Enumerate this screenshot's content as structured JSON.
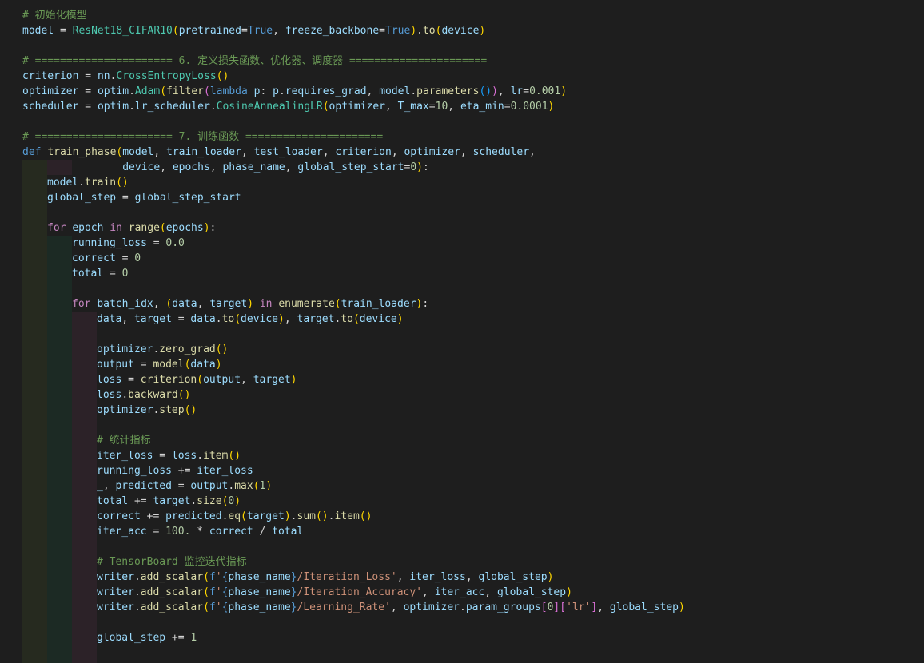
{
  "theme": {
    "background": "#1e1e1e",
    "token_colors": {
      "p": "#d4d4d4",
      "v": "#9cdcfe",
      "f": "#dcdcaa",
      "c": "#4ec9b0",
      "k": "#569cd6",
      "ctl": "#c586c0",
      "n": "#b5cea8",
      "s": "#ce9178",
      "cm": "#6a9955",
      "b1": "#ffd700",
      "b2": "#da70d6",
      "b3": "#179fff"
    },
    "indent_guide_colors": [
      "#262a1f",
      "#1c2a24",
      "#2c2228",
      "#1f2430"
    ]
  },
  "code_lines": [
    {
      "indent": 0,
      "tokens": [
        [
          "cm",
          "# 初始化模型"
        ]
      ]
    },
    {
      "indent": 0,
      "tokens": [
        [
          "v",
          "model"
        ],
        [
          "p",
          " = "
        ],
        [
          "c",
          "ResNet18_CIFAR10"
        ],
        [
          "b1",
          "("
        ],
        [
          "v",
          "pretrained"
        ],
        [
          "p",
          "="
        ],
        [
          "k",
          "True"
        ],
        [
          "p",
          ", "
        ],
        [
          "v",
          "freeze_backbone"
        ],
        [
          "p",
          "="
        ],
        [
          "k",
          "True"
        ],
        [
          "b1",
          ")"
        ],
        [
          "p",
          "."
        ],
        [
          "f",
          "to"
        ],
        [
          "b1",
          "("
        ],
        [
          "v",
          "device"
        ],
        [
          "b1",
          ")"
        ]
      ]
    },
    {
      "indent": 0,
      "tokens": []
    },
    {
      "indent": 0,
      "tokens": [
        [
          "cm",
          "# ====================== 6. 定义损失函数、优化器、调度器 ======================"
        ]
      ]
    },
    {
      "indent": 0,
      "tokens": [
        [
          "v",
          "criterion"
        ],
        [
          "p",
          " = "
        ],
        [
          "v",
          "nn"
        ],
        [
          "p",
          "."
        ],
        [
          "c",
          "CrossEntropyLoss"
        ],
        [
          "b1",
          "()"
        ]
      ]
    },
    {
      "indent": 0,
      "tokens": [
        [
          "v",
          "optimizer"
        ],
        [
          "p",
          " = "
        ],
        [
          "v",
          "optim"
        ],
        [
          "p",
          "."
        ],
        [
          "c",
          "Adam"
        ],
        [
          "b1",
          "("
        ],
        [
          "f",
          "filter"
        ],
        [
          "b2",
          "("
        ],
        [
          "k",
          "lambda"
        ],
        [
          "p",
          " "
        ],
        [
          "v",
          "p"
        ],
        [
          "p",
          ": "
        ],
        [
          "v",
          "p"
        ],
        [
          "p",
          "."
        ],
        [
          "v",
          "requires_grad"
        ],
        [
          "p",
          ", "
        ],
        [
          "v",
          "model"
        ],
        [
          "p",
          "."
        ],
        [
          "f",
          "parameters"
        ],
        [
          "b3",
          "()"
        ],
        [
          "b2",
          ")"
        ],
        [
          "p",
          ", "
        ],
        [
          "v",
          "lr"
        ],
        [
          "p",
          "="
        ],
        [
          "n",
          "0.001"
        ],
        [
          "b1",
          ")"
        ]
      ]
    },
    {
      "indent": 0,
      "tokens": [
        [
          "v",
          "scheduler"
        ],
        [
          "p",
          " = "
        ],
        [
          "v",
          "optim"
        ],
        [
          "p",
          "."
        ],
        [
          "v",
          "lr_scheduler"
        ],
        [
          "p",
          "."
        ],
        [
          "c",
          "CosineAnnealingLR"
        ],
        [
          "b1",
          "("
        ],
        [
          "v",
          "optimizer"
        ],
        [
          "p",
          ", "
        ],
        [
          "v",
          "T_max"
        ],
        [
          "p",
          "="
        ],
        [
          "n",
          "10"
        ],
        [
          "p",
          ", "
        ],
        [
          "v",
          "eta_min"
        ],
        [
          "p",
          "="
        ],
        [
          "n",
          "0.0001"
        ],
        [
          "b1",
          ")"
        ]
      ]
    },
    {
      "indent": 0,
      "tokens": []
    },
    {
      "indent": 0,
      "tokens": [
        [
          "cm",
          "# ====================== 7. 训练函数 ======================"
        ]
      ]
    },
    {
      "indent": 0,
      "tokens": [
        [
          "k",
          "def"
        ],
        [
          "p",
          " "
        ],
        [
          "f",
          "train_phase"
        ],
        [
          "b1",
          "("
        ],
        [
          "v",
          "model"
        ],
        [
          "p",
          ", "
        ],
        [
          "v",
          "train_loader"
        ],
        [
          "p",
          ", "
        ],
        [
          "v",
          "test_loader"
        ],
        [
          "p",
          ", "
        ],
        [
          "v",
          "criterion"
        ],
        [
          "p",
          ", "
        ],
        [
          "v",
          "optimizer"
        ],
        [
          "p",
          ", "
        ],
        [
          "v",
          "scheduler"
        ],
        [
          "p",
          ","
        ]
      ]
    },
    {
      "indent": 0,
      "tokens": [
        [
          "p",
          "                "
        ],
        [
          "v",
          "device"
        ],
        [
          "p",
          ", "
        ],
        [
          "v",
          "epochs"
        ],
        [
          "p",
          ", "
        ],
        [
          "v",
          "phase_name"
        ],
        [
          "p",
          ", "
        ],
        [
          "v",
          "global_step_start"
        ],
        [
          "p",
          "="
        ],
        [
          "n",
          "0"
        ],
        [
          "b1",
          ")"
        ],
        [
          "p",
          ":"
        ]
      ]
    },
    {
      "indent": 1,
      "tokens": [
        [
          "v",
          "model"
        ],
        [
          "p",
          "."
        ],
        [
          "f",
          "train"
        ],
        [
          "b1",
          "()"
        ]
      ]
    },
    {
      "indent": 1,
      "tokens": [
        [
          "v",
          "global_step"
        ],
        [
          "p",
          " = "
        ],
        [
          "v",
          "global_step_start"
        ]
      ]
    },
    {
      "indent": 1,
      "tokens": []
    },
    {
      "indent": 1,
      "tokens": [
        [
          "ctl",
          "for"
        ],
        [
          "p",
          " "
        ],
        [
          "v",
          "epoch"
        ],
        [
          "p",
          " "
        ],
        [
          "ctl",
          "in"
        ],
        [
          "p",
          " "
        ],
        [
          "f",
          "range"
        ],
        [
          "b1",
          "("
        ],
        [
          "v",
          "epochs"
        ],
        [
          "b1",
          ")"
        ],
        [
          "p",
          ":"
        ]
      ]
    },
    {
      "indent": 2,
      "tokens": [
        [
          "v",
          "running_loss"
        ],
        [
          "p",
          " = "
        ],
        [
          "n",
          "0.0"
        ]
      ]
    },
    {
      "indent": 2,
      "tokens": [
        [
          "v",
          "correct"
        ],
        [
          "p",
          " = "
        ],
        [
          "n",
          "0"
        ]
      ]
    },
    {
      "indent": 2,
      "tokens": [
        [
          "v",
          "total"
        ],
        [
          "p",
          " = "
        ],
        [
          "n",
          "0"
        ]
      ]
    },
    {
      "indent": 2,
      "tokens": []
    },
    {
      "indent": 2,
      "tokens": [
        [
          "ctl",
          "for"
        ],
        [
          "p",
          " "
        ],
        [
          "v",
          "batch_idx"
        ],
        [
          "p",
          ", "
        ],
        [
          "b1",
          "("
        ],
        [
          "v",
          "data"
        ],
        [
          "p",
          ", "
        ],
        [
          "v",
          "target"
        ],
        [
          "b1",
          ")"
        ],
        [
          "p",
          " "
        ],
        [
          "ctl",
          "in"
        ],
        [
          "p",
          " "
        ],
        [
          "f",
          "enumerate"
        ],
        [
          "b1",
          "("
        ],
        [
          "v",
          "train_loader"
        ],
        [
          "b1",
          ")"
        ],
        [
          "p",
          ":"
        ]
      ]
    },
    {
      "indent": 3,
      "tokens": [
        [
          "v",
          "data"
        ],
        [
          "p",
          ", "
        ],
        [
          "v",
          "target"
        ],
        [
          "p",
          " = "
        ],
        [
          "v",
          "data"
        ],
        [
          "p",
          "."
        ],
        [
          "f",
          "to"
        ],
        [
          "b1",
          "("
        ],
        [
          "v",
          "device"
        ],
        [
          "b1",
          ")"
        ],
        [
          "p",
          ", "
        ],
        [
          "v",
          "target"
        ],
        [
          "p",
          "."
        ],
        [
          "f",
          "to"
        ],
        [
          "b1",
          "("
        ],
        [
          "v",
          "device"
        ],
        [
          "b1",
          ")"
        ]
      ]
    },
    {
      "indent": 3,
      "tokens": []
    },
    {
      "indent": 3,
      "tokens": [
        [
          "v",
          "optimizer"
        ],
        [
          "p",
          "."
        ],
        [
          "f",
          "zero_grad"
        ],
        [
          "b1",
          "()"
        ]
      ]
    },
    {
      "indent": 3,
      "tokens": [
        [
          "v",
          "output"
        ],
        [
          "p",
          " = "
        ],
        [
          "f",
          "model"
        ],
        [
          "b1",
          "("
        ],
        [
          "v",
          "data"
        ],
        [
          "b1",
          ")"
        ]
      ]
    },
    {
      "indent": 3,
      "tokens": [
        [
          "v",
          "loss"
        ],
        [
          "p",
          " = "
        ],
        [
          "f",
          "criterion"
        ],
        [
          "b1",
          "("
        ],
        [
          "v",
          "output"
        ],
        [
          "p",
          ", "
        ],
        [
          "v",
          "target"
        ],
        [
          "b1",
          ")"
        ]
      ]
    },
    {
      "indent": 3,
      "tokens": [
        [
          "v",
          "loss"
        ],
        [
          "p",
          "."
        ],
        [
          "f",
          "backward"
        ],
        [
          "b1",
          "()"
        ]
      ]
    },
    {
      "indent": 3,
      "tokens": [
        [
          "v",
          "optimizer"
        ],
        [
          "p",
          "."
        ],
        [
          "f",
          "step"
        ],
        [
          "b1",
          "()"
        ]
      ]
    },
    {
      "indent": 3,
      "tokens": []
    },
    {
      "indent": 3,
      "tokens": [
        [
          "cm",
          "# 统计指标"
        ]
      ]
    },
    {
      "indent": 3,
      "tokens": [
        [
          "v",
          "iter_loss"
        ],
        [
          "p",
          " = "
        ],
        [
          "v",
          "loss"
        ],
        [
          "p",
          "."
        ],
        [
          "f",
          "item"
        ],
        [
          "b1",
          "()"
        ]
      ]
    },
    {
      "indent": 3,
      "tokens": [
        [
          "v",
          "running_loss"
        ],
        [
          "p",
          " += "
        ],
        [
          "v",
          "iter_loss"
        ]
      ]
    },
    {
      "indent": 3,
      "tokens": [
        [
          "v",
          "_"
        ],
        [
          "p",
          ", "
        ],
        [
          "v",
          "predicted"
        ],
        [
          "p",
          " = "
        ],
        [
          "v",
          "output"
        ],
        [
          "p",
          "."
        ],
        [
          "f",
          "max"
        ],
        [
          "b1",
          "("
        ],
        [
          "n",
          "1"
        ],
        [
          "b1",
          ")"
        ]
      ]
    },
    {
      "indent": 3,
      "tokens": [
        [
          "v",
          "total"
        ],
        [
          "p",
          " += "
        ],
        [
          "v",
          "target"
        ],
        [
          "p",
          "."
        ],
        [
          "f",
          "size"
        ],
        [
          "b1",
          "("
        ],
        [
          "n",
          "0"
        ],
        [
          "b1",
          ")"
        ]
      ]
    },
    {
      "indent": 3,
      "tokens": [
        [
          "v",
          "correct"
        ],
        [
          "p",
          " += "
        ],
        [
          "v",
          "predicted"
        ],
        [
          "p",
          "."
        ],
        [
          "f",
          "eq"
        ],
        [
          "b1",
          "("
        ],
        [
          "v",
          "target"
        ],
        [
          "b1",
          ")"
        ],
        [
          "p",
          "."
        ],
        [
          "f",
          "sum"
        ],
        [
          "b1",
          "()"
        ],
        [
          "p",
          "."
        ],
        [
          "f",
          "item"
        ],
        [
          "b1",
          "()"
        ]
      ]
    },
    {
      "indent": 3,
      "tokens": [
        [
          "v",
          "iter_acc"
        ],
        [
          "p",
          " = "
        ],
        [
          "n",
          "100."
        ],
        [
          "p",
          " * "
        ],
        [
          "v",
          "correct"
        ],
        [
          "p",
          " / "
        ],
        [
          "v",
          "total"
        ]
      ]
    },
    {
      "indent": 3,
      "tokens": []
    },
    {
      "indent": 3,
      "tokens": [
        [
          "cm",
          "# TensorBoard 监控迭代指标"
        ]
      ]
    },
    {
      "indent": 3,
      "tokens": [
        [
          "v",
          "writer"
        ],
        [
          "p",
          "."
        ],
        [
          "f",
          "add_scalar"
        ],
        [
          "b1",
          "("
        ],
        [
          "k",
          "f"
        ],
        [
          "s",
          "'"
        ],
        [
          "k",
          "{"
        ],
        [
          "v",
          "phase_name"
        ],
        [
          "k",
          "}"
        ],
        [
          "s",
          "/Iteration_Loss'"
        ],
        [
          "p",
          ", "
        ],
        [
          "v",
          "iter_loss"
        ],
        [
          "p",
          ", "
        ],
        [
          "v",
          "global_step"
        ],
        [
          "b1",
          ")"
        ]
      ]
    },
    {
      "indent": 3,
      "tokens": [
        [
          "v",
          "writer"
        ],
        [
          "p",
          "."
        ],
        [
          "f",
          "add_scalar"
        ],
        [
          "b1",
          "("
        ],
        [
          "k",
          "f"
        ],
        [
          "s",
          "'"
        ],
        [
          "k",
          "{"
        ],
        [
          "v",
          "phase_name"
        ],
        [
          "k",
          "}"
        ],
        [
          "s",
          "/Iteration_Accuracy'"
        ],
        [
          "p",
          ", "
        ],
        [
          "v",
          "iter_acc"
        ],
        [
          "p",
          ", "
        ],
        [
          "v",
          "global_step"
        ],
        [
          "b1",
          ")"
        ]
      ]
    },
    {
      "indent": 3,
      "tokens": [
        [
          "v",
          "writer"
        ],
        [
          "p",
          "."
        ],
        [
          "f",
          "add_scalar"
        ],
        [
          "b1",
          "("
        ],
        [
          "k",
          "f"
        ],
        [
          "s",
          "'"
        ],
        [
          "k",
          "{"
        ],
        [
          "v",
          "phase_name"
        ],
        [
          "k",
          "}"
        ],
        [
          "s",
          "/Learning_Rate'"
        ],
        [
          "p",
          ", "
        ],
        [
          "v",
          "optimizer"
        ],
        [
          "p",
          "."
        ],
        [
          "v",
          "param_groups"
        ],
        [
          "b2",
          "["
        ],
        [
          "n",
          "0"
        ],
        [
          "b2",
          "]["
        ],
        [
          "s",
          "'lr'"
        ],
        [
          "b2",
          "]"
        ],
        [
          "p",
          ", "
        ],
        [
          "v",
          "global_step"
        ],
        [
          "b1",
          ")"
        ]
      ]
    },
    {
      "indent": 3,
      "tokens": []
    },
    {
      "indent": 3,
      "tokens": [
        [
          "v",
          "global_step"
        ],
        [
          "p",
          " += "
        ],
        [
          "n",
          "1"
        ]
      ]
    },
    {
      "indent": 3,
      "tokens": []
    }
  ]
}
